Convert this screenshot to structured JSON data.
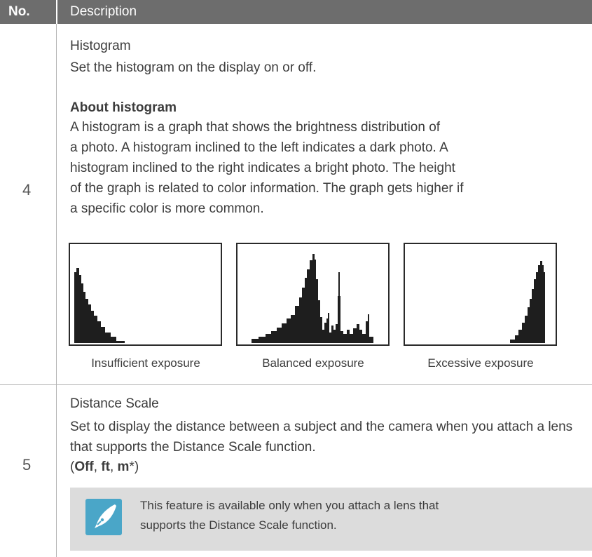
{
  "header": {
    "no": "No.",
    "description": "Description"
  },
  "rows": [
    {
      "no": "4",
      "title": "Histogram",
      "line": "Set the histogram on the display on or off.",
      "subheading": "About histogram",
      "paragraph": "A histogram is a graph that shows the brightness distribution of\na photo. A histogram inclined to the left indicates a dark photo. A\nhistogram inclined to the right indicates a bright photo. The height\nof the graph is related to color information. The graph gets higher if\na specific color is more common.",
      "figures": [
        {
          "caption": "Insufficient exposure"
        },
        {
          "caption": "Balanced exposure"
        },
        {
          "caption": "Excessive exposure"
        }
      ]
    },
    {
      "no": "5",
      "title": "Distance Scale",
      "line": "Set to display the distance between a subject and the camera when you attach a lens that supports the Distance Scale function.",
      "options": {
        "open": "(",
        "off": "Off",
        "sep1": ", ",
        "ft": "ft",
        "sep2": ", ",
        "m": "m",
        "close": "*)"
      },
      "note": "This feature is available only when you attach a lens that supports the Distance Scale function."
    }
  ],
  "colors": {
    "header_bg": "#6d6d6d",
    "note_bg": "#dcdcdc",
    "icon_bg": "#4aa6c8"
  },
  "icons": {
    "note": "pen-nib-icon"
  }
}
